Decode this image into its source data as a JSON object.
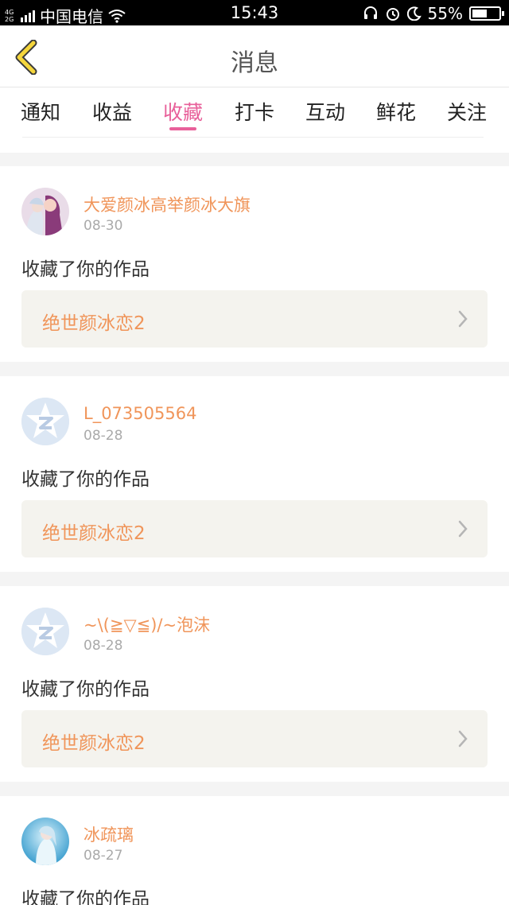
{
  "status_bar": {
    "network": "4G\n2G",
    "carrier": "中国电信",
    "time": "15:43",
    "battery": "55%",
    "battery_level": 0.55
  },
  "header": {
    "title": "消息"
  },
  "tabs": [
    {
      "label": "通知"
    },
    {
      "label": "收益"
    },
    {
      "label": "收藏",
      "active": true
    },
    {
      "label": "打卡"
    },
    {
      "label": "互动"
    },
    {
      "label": "鲜花"
    },
    {
      "label": "关注"
    }
  ],
  "messages": [
    {
      "username": "大爱颜冰高举颜冰大旗",
      "date": "08-30",
      "action": "收藏了你的作品",
      "work": "绝世颜冰恋2"
    },
    {
      "username": "L_073505564",
      "date": "08-28",
      "action": "收藏了你的作品",
      "work": "绝世颜冰恋2"
    },
    {
      "username": "~\\(≧▽≦)/~泡沫",
      "date": "08-28",
      "action": "收藏了你的作品",
      "work": "绝世颜冰恋2"
    },
    {
      "username": "冰疏璃",
      "date": "08-27",
      "action": "收藏了你的作品"
    }
  ],
  "colors": {
    "accent_pink": "#e8609a",
    "accent_orange": "#f0955a"
  }
}
